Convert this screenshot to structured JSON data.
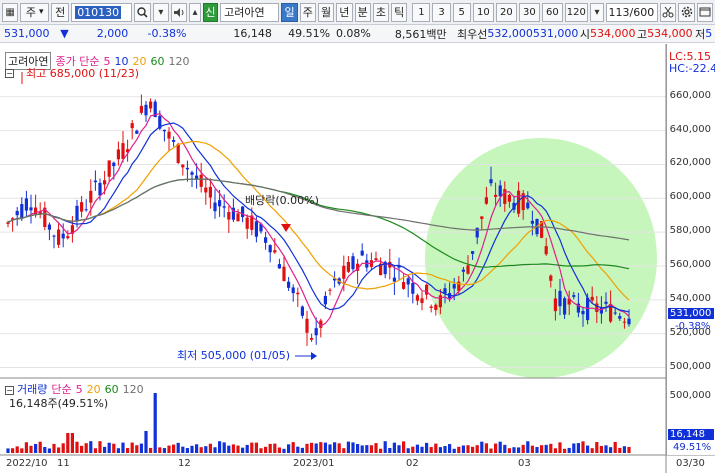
{
  "toolbar": {
    "btn_grid": "▦",
    "market_label": "주",
    "market_arrow": "▾",
    "prev_label": "전",
    "code": "010130",
    "search_icon": "magnifier",
    "down_btn": "▾",
    "speaker": "speaker",
    "sort_btn": "▴",
    "new_badge": "신",
    "stock_name": "고려아연",
    "periods": [
      "일",
      "주",
      "월",
      "년",
      "분",
      "초",
      "틱"
    ],
    "active_period": "일",
    "numbers": [
      "1",
      "3",
      "5",
      "10",
      "20",
      "30",
      "60",
      "120"
    ],
    "count": "113/600",
    "right_icons": [
      "scissors",
      "settings",
      "window"
    ]
  },
  "info": {
    "price": "531,000",
    "change_arrow": "▼",
    "change": "2,000",
    "change_pct": "-0.38%",
    "volume": "16,148",
    "volume_pct": "49.51%",
    "rate": "0.08%",
    "amount": "8,561백만",
    "best_label": "최우선",
    "ask": "532,000",
    "bid": "531,000",
    "open_label": "시",
    "open": "534,000",
    "high_label": "고",
    "high": "534,000",
    "low_label": "저",
    "low": "5"
  },
  "price_chart": {
    "legend_name": "고려아연",
    "legend_ma": "종가 단순",
    "legend_periods": [
      "5",
      "10",
      "20",
      "60",
      "120"
    ],
    "legend_colors": [
      "#e0208c",
      "#1030d8",
      "#f0a000",
      "#1a8a1a",
      "#707070"
    ],
    "lc": "LC:5.15",
    "hc": "HC:-22.4",
    "y_labels": [
      "660,000",
      "640,000",
      "620,000",
      "600,000",
      "580,000",
      "560,000",
      "540,000",
      "520,000",
      "500,000"
    ],
    "y_values": [
      660000,
      640000,
      620000,
      600000,
      580000,
      560000,
      540000,
      520000,
      500000
    ],
    "current_tag": "531,000",
    "current_pct": "-0.38%",
    "high_annotation": "최고 685,000 (11/23)",
    "low_annotation": "최저 505,000 (01/05)",
    "dividend_annotation": "배당락(0.00%)"
  },
  "volume_chart": {
    "legend_name": "거래량",
    "legend_ma": "단순",
    "legend_periods": [
      "5",
      "20",
      "60",
      "120"
    ],
    "value_text": "16,148주(49.51%)",
    "y_label": "500,000",
    "tag_value": "16,148",
    "tag_pct": "49.51%"
  },
  "dates": [
    "2022/10",
    "11",
    "12",
    "2023/01",
    "02",
    "03",
    "03/30"
  ],
  "colors": {
    "up": "#e01010",
    "down": "#1030d8",
    "highlight": "#bdf5b0"
  }
}
